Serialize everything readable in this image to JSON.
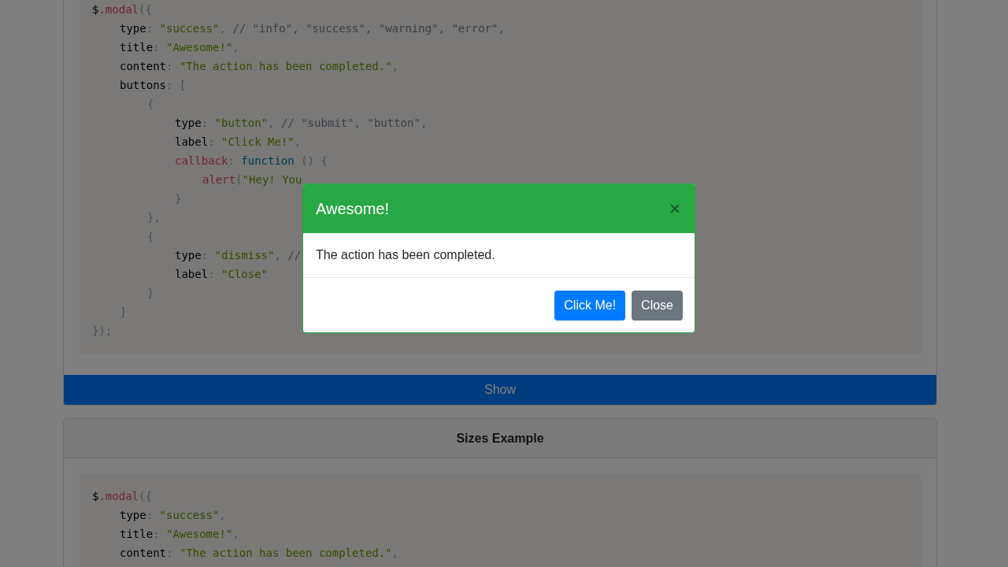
{
  "cards": [
    {
      "code": [
        {
          "tokens": [
            {
              "kind": "plain",
              "text": "$"
            },
            {
              "kind": "func",
              "text": ".modal"
            },
            {
              "kind": "punct",
              "text": "({"
            }
          ],
          "children": [
            {
              "tokens": [
                {
                  "kind": "key",
                  "text": "type"
                },
                {
                  "kind": "punct",
                  "text": ": "
                },
                {
                  "kind": "string",
                  "text": "\"success\""
                },
                {
                  "kind": "punct",
                  "text": ", "
                },
                {
                  "kind": "comment",
                  "text": "// \"info\", \"success\", \"warning\", \"error\","
                }
              ]
            },
            {
              "tokens": [
                {
                  "kind": "key",
                  "text": "title"
                },
                {
                  "kind": "punct",
                  "text": ": "
                },
                {
                  "kind": "string",
                  "text": "\"Awesome!\""
                },
                {
                  "kind": "punct",
                  "text": ","
                }
              ]
            },
            {
              "tokens": [
                {
                  "kind": "key",
                  "text": "content"
                },
                {
                  "kind": "punct",
                  "text": ": "
                },
                {
                  "kind": "string",
                  "text": "\"The action has been completed.\""
                },
                {
                  "kind": "punct",
                  "text": ","
                }
              ]
            },
            {
              "tokens": [
                {
                  "kind": "key",
                  "text": "buttons"
                },
                {
                  "kind": "punct",
                  "text": ": ["
                }
              ],
              "children": [
                {
                  "tokens": [
                    {
                      "kind": "punct",
                      "text": "{"
                    }
                  ],
                  "children": [
                    {
                      "tokens": [
                        {
                          "kind": "key",
                          "text": "type"
                        },
                        {
                          "kind": "punct",
                          "text": ": "
                        },
                        {
                          "kind": "string",
                          "text": "\"button\""
                        },
                        {
                          "kind": "punct",
                          "text": ", "
                        },
                        {
                          "kind": "comment",
                          "text": "// \"submit\", \"button\","
                        }
                      ]
                    },
                    {
                      "tokens": [
                        {
                          "kind": "key",
                          "text": "label"
                        },
                        {
                          "kind": "punct",
                          "text": ": "
                        },
                        {
                          "kind": "string",
                          "text": "\"Click Me!\""
                        },
                        {
                          "kind": "punct",
                          "text": ","
                        }
                      ]
                    },
                    {
                      "tokens": [
                        {
                          "kind": "func",
                          "text": "callback"
                        },
                        {
                          "kind": "punct",
                          "text": ": "
                        },
                        {
                          "kind": "keyword",
                          "text": "function"
                        },
                        {
                          "kind": "punct",
                          "text": " () {"
                        }
                      ],
                      "children": [
                        {
                          "tokens": [
                            {
                              "kind": "func",
                              "text": "alert"
                            },
                            {
                              "kind": "punct",
                              "text": "("
                            },
                            {
                              "kind": "string",
                              "text": "\"Hey! You"
                            }
                          ]
                        }
                      ]
                    },
                    {
                      "tokens": [
                        {
                          "kind": "punct",
                          "text": "}"
                        }
                      ]
                    }
                  ]
                },
                {
                  "tokens": [
                    {
                      "kind": "punct",
                      "text": "},"
                    }
                  ]
                },
                {
                  "tokens": [
                    {
                      "kind": "punct",
                      "text": "{"
                    }
                  ],
                  "children": [
                    {
                      "tokens": [
                        {
                          "kind": "key",
                          "text": "type"
                        },
                        {
                          "kind": "punct",
                          "text": ": "
                        },
                        {
                          "kind": "string",
                          "text": "\"dismiss\""
                        },
                        {
                          "kind": "punct",
                          "text": ", "
                        },
                        {
                          "kind": "comment",
                          "text": "//"
                        }
                      ]
                    },
                    {
                      "tokens": [
                        {
                          "kind": "key",
                          "text": "label"
                        },
                        {
                          "kind": "punct",
                          "text": ": "
                        },
                        {
                          "kind": "string",
                          "text": "\"Close\""
                        }
                      ]
                    }
                  ]
                },
                {
                  "tokens": [
                    {
                      "kind": "punct",
                      "text": "}"
                    }
                  ]
                }
              ]
            },
            {
              "tokens": [
                {
                  "kind": "punct",
                  "text": "]"
                }
              ]
            }
          ]
        },
        {
          "tokens": [
            {
              "kind": "punct",
              "text": "});"
            }
          ]
        }
      ],
      "button": "Show"
    },
    {
      "header": "Sizes Example",
      "code": [
        {
          "tokens": [
            {
              "kind": "plain",
              "text": "$"
            },
            {
              "kind": "func",
              "text": ".modal"
            },
            {
              "kind": "punct",
              "text": "({"
            }
          ],
          "children": [
            {
              "tokens": [
                {
                  "kind": "key",
                  "text": "type"
                },
                {
                  "kind": "punct",
                  "text": ": "
                },
                {
                  "kind": "string",
                  "text": "\"success\""
                },
                {
                  "kind": "punct",
                  "text": ","
                }
              ]
            },
            {
              "tokens": [
                {
                  "kind": "key",
                  "text": "title"
                },
                {
                  "kind": "punct",
                  "text": ": "
                },
                {
                  "kind": "string",
                  "text": "\"Awesome!\""
                },
                {
                  "kind": "punct",
                  "text": ","
                }
              ]
            },
            {
              "tokens": [
                {
                  "kind": "key",
                  "text": "content"
                },
                {
                  "kind": "punct",
                  "text": ": "
                },
                {
                  "kind": "string",
                  "text": "\"The action has been completed.\""
                },
                {
                  "kind": "punct",
                  "text": ","
                }
              ]
            }
          ]
        }
      ]
    }
  ],
  "modal": {
    "title": "Awesome!",
    "close": "×",
    "content": "The action has been completed.",
    "buttons": [
      {
        "label": "Click Me!",
        "kind": "primary"
      },
      {
        "label": "Close",
        "kind": "secondary"
      }
    ]
  }
}
